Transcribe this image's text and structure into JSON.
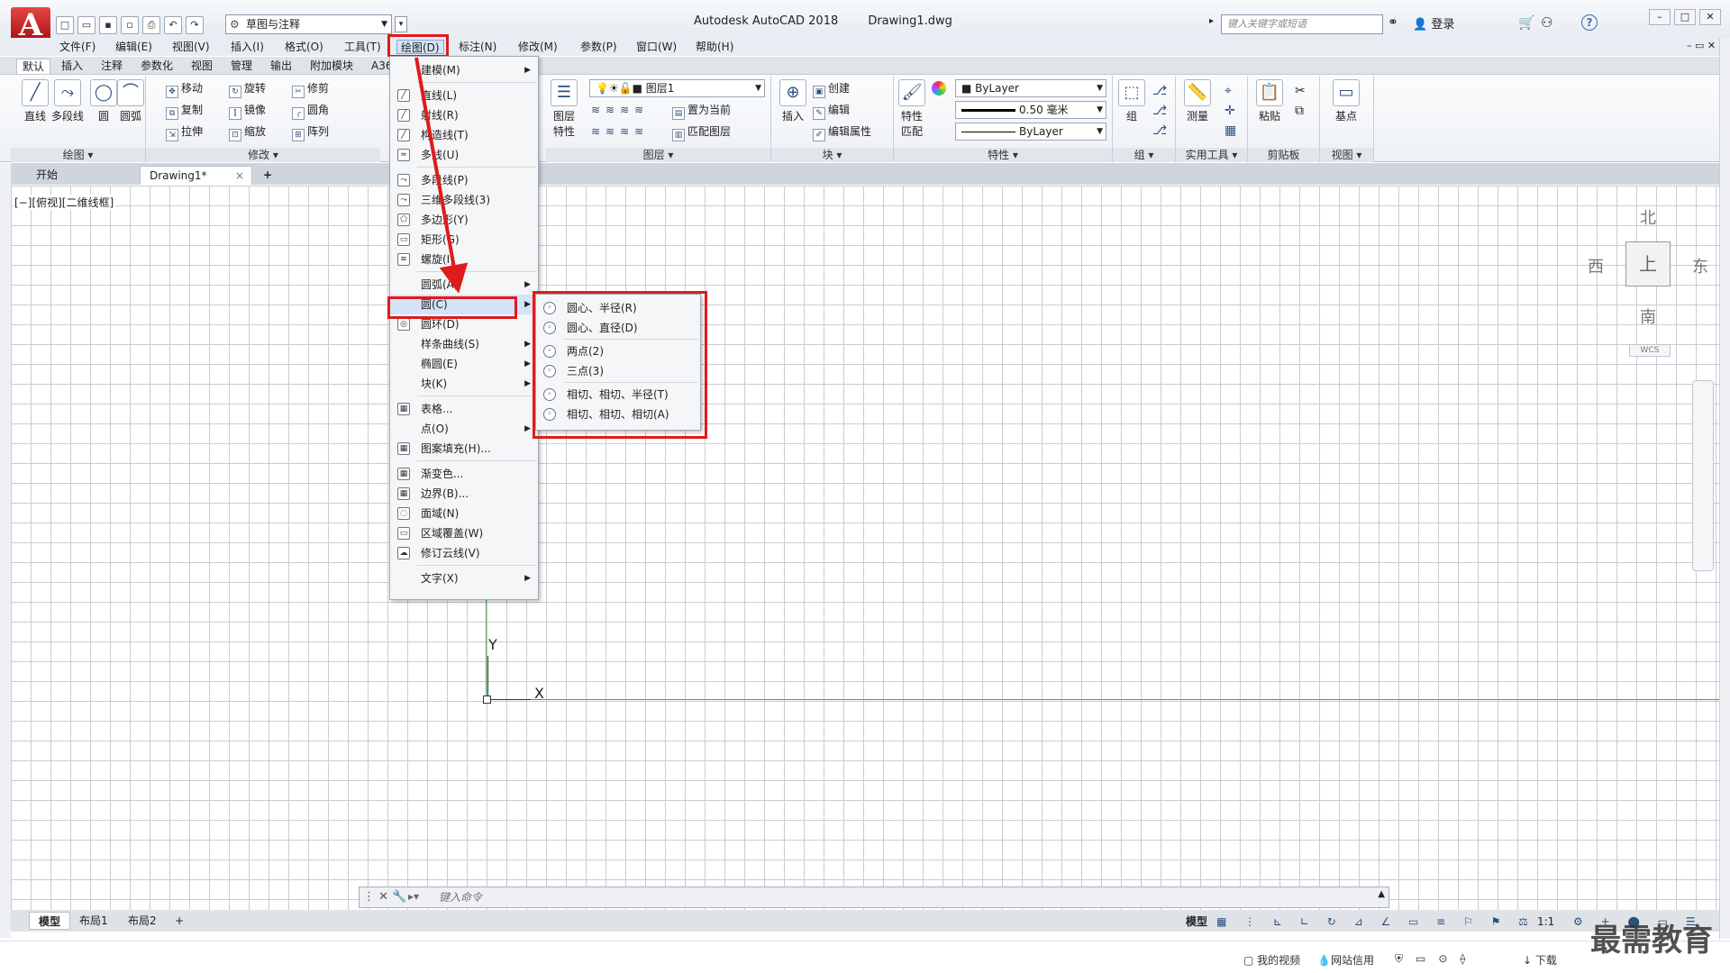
{
  "app": {
    "logo": "A",
    "title": "Autodesk AutoCAD 2018",
    "document": "Drawing1.dwg",
    "workspace": "草图与注释",
    "search_placeholder": "键入关键字或短语",
    "login": "登录"
  },
  "menubar": [
    "文件(F)",
    "编辑(E)",
    "视图(V)",
    "插入(I)",
    "格式(O)",
    "工具(T)",
    "绘图(D)",
    "标注(N)",
    "修改(M)",
    "参数(P)",
    "窗口(W)",
    "帮助(H)"
  ],
  "ribbon_tabs": [
    "默认",
    "插入",
    "注释",
    "参数化",
    "视图",
    "管理",
    "输出",
    "附加模块",
    "A36"
  ],
  "ribbon": {
    "draw": {
      "label": "绘图 ▾",
      "line": "直线",
      "polyline": "多段线",
      "circle": "圆",
      "arc": "圆弧"
    },
    "modify": {
      "label": "修改 ▾",
      "move": "移动",
      "rotate": "旋转",
      "trim": "修剪",
      "copy": "复制",
      "mirror": "镜像",
      "fillet": "圆角",
      "stretch": "拉伸",
      "scale": "缩放",
      "array": "阵列"
    },
    "layers": {
      "label": "图层 ▾",
      "layer_props_1": "图层",
      "layer_props_2": "特性",
      "current_layer": "图层1",
      "set_current": "置为当前",
      "match_layer": "匹配图层"
    },
    "block": {
      "label": "块 ▾",
      "insert": "插入",
      "create": "创建",
      "edit": "编辑",
      "edit_attr": "编辑属性"
    },
    "properties": {
      "label": "特性 ▾",
      "match_1": "特性",
      "match_2": "匹配",
      "color": "ByLayer",
      "lineweight": "0.50 毫米",
      "linetype": "ByLayer"
    },
    "groups": {
      "label": "组 ▾",
      "group": "组"
    },
    "utilities": {
      "label": "实用工具 ▾",
      "measure": "测量"
    },
    "clipboard": {
      "label": "剪贴板",
      "paste": "粘贴"
    },
    "view": {
      "label": "视图 ▾",
      "base": "基点"
    }
  },
  "doc_tabs": {
    "start": "开始",
    "drawing": "Drawing1*",
    "close": "×",
    "add": "+"
  },
  "viewport_label": "[−][俯视][二维线框]",
  "viewcube": {
    "north": "北",
    "south": "南",
    "east": "东",
    "west": "西",
    "face": "上",
    "wcs": "WCS"
  },
  "ucs": {
    "x": "X",
    "y": "Y"
  },
  "draw_menu": {
    "items": [
      {
        "label": "建模(M)",
        "sub": true
      },
      {
        "label": "直线(L)"
      },
      {
        "label": "射线(R)"
      },
      {
        "label": "构造线(T)"
      },
      {
        "label": "多线(U)"
      },
      {
        "label": "多段线(P)"
      },
      {
        "label": "三维多段线(3)"
      },
      {
        "label": "多边形(Y)"
      },
      {
        "label": "矩形(G)"
      },
      {
        "label": "螺旋(I)"
      },
      {
        "label": "圆弧(A)",
        "sub": true
      },
      {
        "label": "圆(C)",
        "sub": true
      },
      {
        "label": "圆环(D)"
      },
      {
        "label": "样条曲线(S)",
        "sub": true
      },
      {
        "label": "椭圆(E)",
        "sub": true
      },
      {
        "label": "块(K)",
        "sub": true
      },
      {
        "label": "表格..."
      },
      {
        "label": "点(O)",
        "sub": true
      },
      {
        "label": "图案填充(H)..."
      },
      {
        "label": "渐变色..."
      },
      {
        "label": "边界(B)..."
      },
      {
        "label": "面域(N)"
      },
      {
        "label": "区域覆盖(W)"
      },
      {
        "label": "修订云线(V)"
      },
      {
        "label": "文字(X)",
        "sub": true
      }
    ]
  },
  "circle_submenu": [
    "圆心、半径(R)",
    "圆心、直径(D)",
    "两点(2)",
    "三点(3)",
    "相切、相切、半径(T)",
    "相切、相切、相切(A)"
  ],
  "command_line": {
    "placeholder": "键入命令"
  },
  "layout_tabs": [
    "模型",
    "布局1",
    "布局2",
    "+"
  ],
  "status": {
    "model": "模型",
    "scale": "1:1"
  },
  "taskbar": {
    "video": "我的视频",
    "credit": "网站信用",
    "download": "下载"
  },
  "watermark": "最需教育",
  "colors": {
    "highlight_box": "#e01b1b",
    "menu_hover": "#d4e3f7",
    "x_axis": "#d05a5a",
    "y_axis": "#4caf50"
  }
}
